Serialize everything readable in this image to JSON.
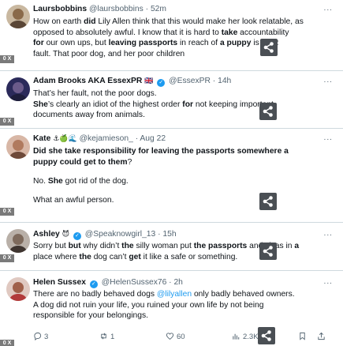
{
  "tweets": [
    {
      "name": "Laursbobbins",
      "handle": "@laursbobbins",
      "time": "52m",
      "lines": [
        [
          {
            "t": "How on earth "
          },
          {
            "t": "did",
            "b": true
          },
          {
            "t": " Lily Allen think that this would make her look relatable, as"
          }
        ],
        [
          {
            "t": "opposed to absolutely awful. I know that it is hard to "
          },
          {
            "t": "take",
            "b": true
          },
          {
            "t": " accountability"
          }
        ],
        [
          {
            "t": "for",
            "b": true
          },
          {
            "t": " our own "
          },
          {
            "t": "       "
          },
          {
            "t": " ups, but "
          },
          {
            "t": "leaving passports",
            "b": true
          },
          {
            "t": " in reach of "
          },
          {
            "t": "a puppy",
            "b": true
          },
          {
            "t": " is HER"
          }
        ],
        [
          {
            "t": "fault. That poor dog, and her poor children"
          }
        ]
      ]
    },
    {
      "name": "Adam Brooks AKA EssexPR",
      "flag": "🇬🇧",
      "handle": "@EssexPR",
      "time": "14h",
      "lines": [
        [
          {
            "t": "That’s her fault, not the poor dogs."
          }
        ],
        [
          {
            "t": "She",
            "b": true
          },
          {
            "t": "’s clearly an idiot of the highest order "
          },
          {
            "t": "for",
            "b": true
          },
          {
            "t": " not keeping important"
          }
        ],
        [
          {
            "t": "documents away from animals."
          }
        ]
      ]
    },
    {
      "name": "Kate",
      "emojis": "⚓🍏🌊",
      "handle": "@kejamieson_",
      "time": "Aug 22",
      "lines": [
        [
          {
            "t": "Did she take responsibility for leaving the passports somewhere a",
            "b": true
          }
        ],
        [
          {
            "t": "puppy could get to them",
            "b": true
          },
          {
            "t": "?"
          }
        ],
        [],
        [
          {
            "t": "No. "
          },
          {
            "t": "She",
            "b": true
          },
          {
            "t": " got rid of the dog."
          }
        ],
        [],
        [
          {
            "t": "What an awful person."
          }
        ]
      ]
    },
    {
      "name": "Ashley",
      "emojis": "😈",
      "handle": "@Speaknowgirl_13",
      "time": "15h",
      "lines": [
        [
          {
            "t": "Sorry but "
          },
          {
            "t": "but",
            "b": true
          },
          {
            "t": " why didn’t "
          },
          {
            "t": "the",
            "b": true
          },
          {
            "t": " silly woman put "
          },
          {
            "t": "the passports",
            "b": true
          },
          {
            "t": " and visas in "
          },
          {
            "t": "a",
            "b": true
          }
        ],
        [
          {
            "t": "place where "
          },
          {
            "t": "the",
            "b": true
          },
          {
            "t": " dog can’t "
          },
          {
            "t": "get",
            "b": true
          },
          {
            "t": " it like a safe or something."
          }
        ]
      ]
    },
    {
      "name": "Helen Sussex",
      "handle": "@HelenSussex76",
      "time": "2h",
      "lines": [
        [
          {
            "t": "There are no badly behaved dogs "
          },
          {
            "t": "@lilyallen",
            "m": true
          },
          {
            "t": " only badly behaved owners."
          }
        ],
        [
          {
            "t": "A dog did not ruin your life, you ruined your own life by not being"
          }
        ],
        [
          {
            "t": "responsible for your belongings."
          }
        ]
      ],
      "stats": {
        "replies": "3",
        "retweets": "1",
        "likes": "60",
        "views": "2.3K"
      }
    }
  ],
  "ui": {
    "more_glyph": "···",
    "side_tag": "0 X",
    "name_sep": " · ",
    "verified_glyph": "✓"
  },
  "colors": {
    "accent": "#1d9bf0",
    "text": "#0f1419",
    "meta": "#536471",
    "divider": "#cfd9de"
  }
}
